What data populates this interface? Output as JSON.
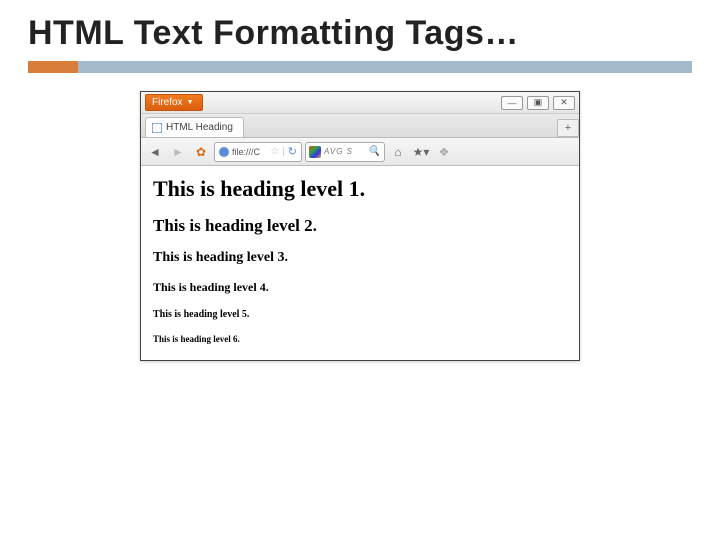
{
  "slide": {
    "title": "HTML Text Formatting Tags…"
  },
  "browser": {
    "app_button": "Firefox",
    "tab_title": "HTML Heading",
    "newtab": "+",
    "url": "file:///C",
    "search_placeholder": "AVG S",
    "window_controls": {
      "min": "—",
      "max": "▣",
      "close": "✕"
    }
  },
  "page": {
    "h1": "This is heading level 1.",
    "h2": "This is heading level 2.",
    "h3": "This is heading level 3.",
    "h4": "This is heading level 4.",
    "h5": "This is heading level 5.",
    "h6": "This is heading level 6."
  }
}
